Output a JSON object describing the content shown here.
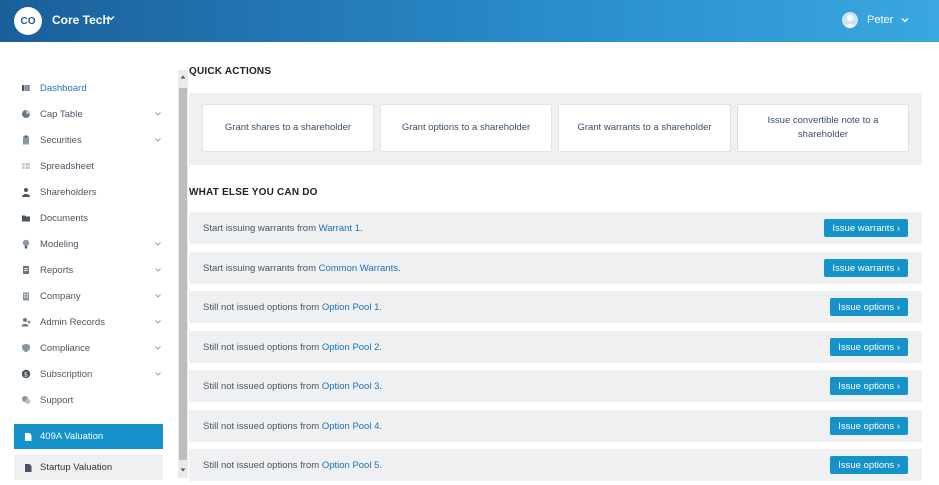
{
  "header": {
    "company_initials": "CO",
    "company_name": "Core Tech",
    "user_name": "Peter"
  },
  "sidebar": {
    "items": [
      {
        "label": "Dashboard",
        "icon": "dashboard-icon",
        "has_chevron": false,
        "active": true
      },
      {
        "label": "Cap Table",
        "icon": "pie-chart-icon",
        "has_chevron": true
      },
      {
        "label": "Securities",
        "icon": "clipboard-icon",
        "has_chevron": true
      },
      {
        "label": "Spreadsheet",
        "icon": "spreadsheet-icon",
        "has_chevron": false
      },
      {
        "label": "Shareholders",
        "icon": "user-icon",
        "has_chevron": false
      },
      {
        "label": "Documents",
        "icon": "folder-icon",
        "has_chevron": false
      },
      {
        "label": "Modeling",
        "icon": "lightbulb-icon",
        "has_chevron": true
      },
      {
        "label": "Reports",
        "icon": "report-icon",
        "has_chevron": true
      },
      {
        "label": "Company",
        "icon": "building-icon",
        "has_chevron": true
      },
      {
        "label": "Admin Records",
        "icon": "admin-icon",
        "has_chevron": true
      },
      {
        "label": "Compliance",
        "icon": "shield-icon",
        "has_chevron": true
      },
      {
        "label": "Subscription",
        "icon": "dollar-icon",
        "has_chevron": true
      },
      {
        "label": "Support",
        "icon": "support-icon",
        "has_chevron": false
      }
    ],
    "primary_button": "409A Valuation",
    "secondary_button": "Startup Valuation"
  },
  "quick_actions": {
    "title": "QUICK ACTIONS",
    "cards": [
      "Grant shares to a shareholder",
      "Grant options to a shareholder",
      "Grant warrants to a shareholder",
      "Issue convertible note to a shareholder"
    ]
  },
  "what_else": {
    "title": "WHAT ELSE YOU CAN DO",
    "rows": [
      {
        "prefix": "Start issuing warrants from ",
        "link": "Warrant 1",
        "suffix": ".",
        "button": "Issue warrants ›"
      },
      {
        "prefix": "Start issuing warrants from ",
        "link": "Common Warrants",
        "suffix": ".",
        "button": "Issue warrants ›"
      },
      {
        "prefix": "Still not issued options from ",
        "link": "Option Pool 1",
        "suffix": ".",
        "button": "Issue options ›"
      },
      {
        "prefix": "Still not issued options from ",
        "link": "Option Pool 2",
        "suffix": ".",
        "button": "Issue options ›"
      },
      {
        "prefix": "Still not issued options from ",
        "link": "Option Pool 3",
        "suffix": ".",
        "button": "Issue options ›"
      },
      {
        "prefix": "Still not issued options from ",
        "link": "Option Pool 4",
        "suffix": ".",
        "button": "Issue options ›"
      },
      {
        "prefix": "Still not issued options from ",
        "link": "Option Pool 5",
        "suffix": ".",
        "button": "Issue options ›"
      }
    ]
  },
  "colors": {
    "accent": "#1592c9",
    "link": "#1d71b8",
    "panel": "#eef0f2"
  }
}
